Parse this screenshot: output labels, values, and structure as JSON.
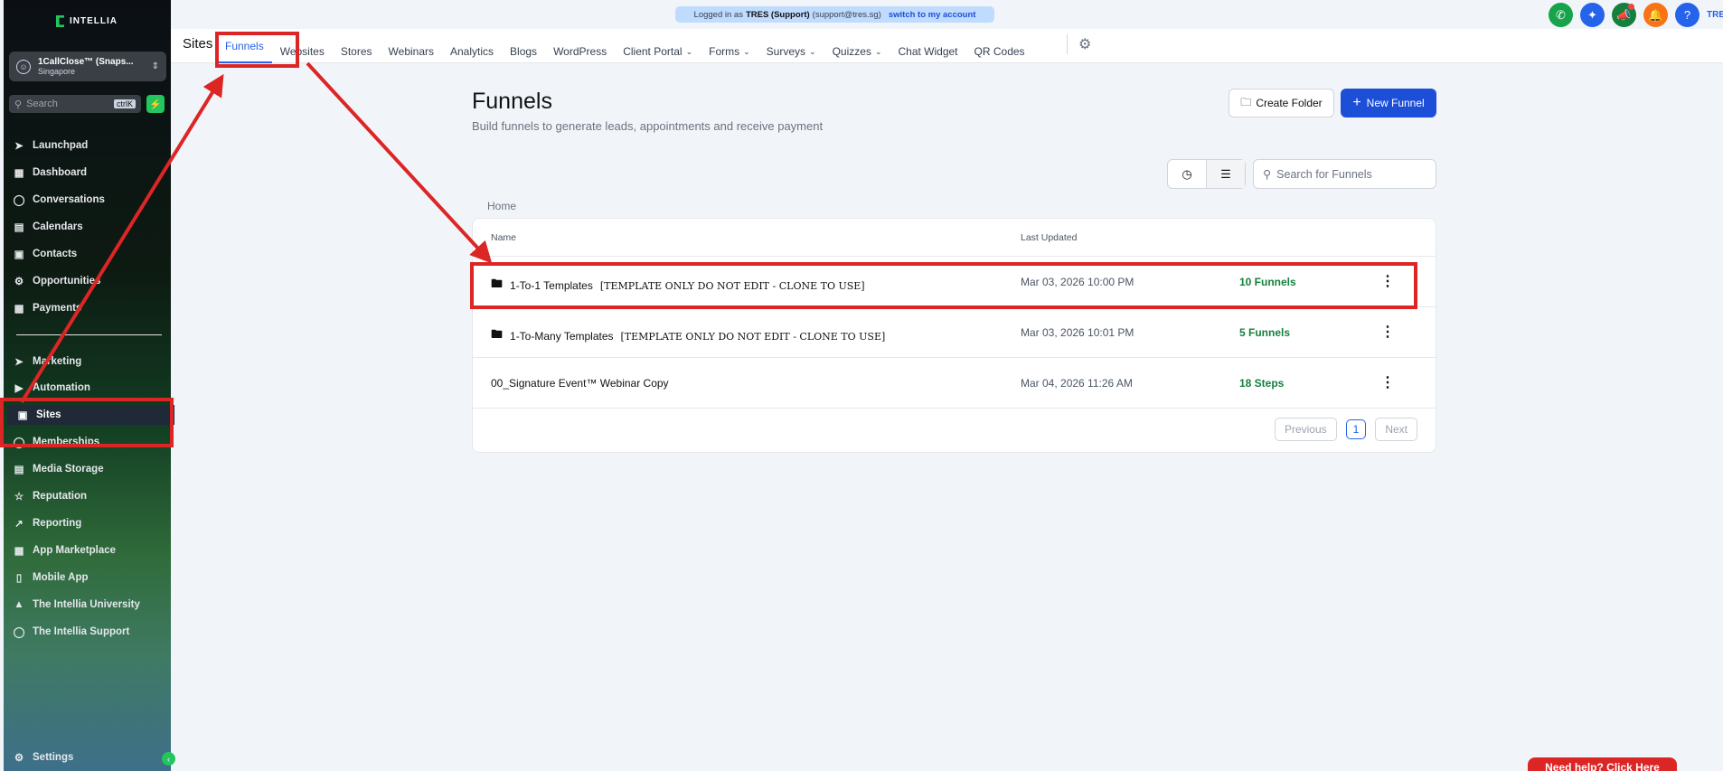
{
  "brand": "INTELLIA",
  "account": {
    "name": "1CallClose™ (Snaps...",
    "location": "Singapore"
  },
  "sidebar_search": {
    "placeholder": "Search",
    "shortcut": "ctrlK"
  },
  "nav": [
    {
      "label": "Launchpad",
      "icon": "rocket-icon"
    },
    {
      "label": "Dashboard",
      "icon": "grid-icon"
    },
    {
      "label": "Conversations",
      "icon": "chat-icon"
    },
    {
      "label": "Calendars",
      "icon": "calendar-icon"
    },
    {
      "label": "Contacts",
      "icon": "contacts-icon"
    },
    {
      "label": "Opportunities",
      "icon": "opportunities-icon"
    },
    {
      "label": "Payments",
      "icon": "payments-icon"
    },
    {
      "label": "Marketing",
      "icon": "send-icon"
    },
    {
      "label": "Automation",
      "icon": "automation-icon"
    },
    {
      "label": "Sites",
      "icon": "sites-icon"
    },
    {
      "label": "Memberships",
      "icon": "memberships-icon"
    },
    {
      "label": "Media Storage",
      "icon": "image-icon"
    },
    {
      "label": "Reputation",
      "icon": "star-icon"
    },
    {
      "label": "Reporting",
      "icon": "trend-icon"
    },
    {
      "label": "App Marketplace",
      "icon": "apps-icon"
    },
    {
      "label": "Mobile App",
      "icon": "phone-icon"
    },
    {
      "label": "The Intellia University",
      "icon": "graduation-icon"
    },
    {
      "label": "The Intellia Support",
      "icon": "headset-icon"
    }
  ],
  "settings_label": "Settings",
  "banner": {
    "prefix": "Logged in as",
    "user": "TRES (Support)",
    "email": "(support@tres.sg)",
    "switch": "switch to my account"
  },
  "top": {
    "section_title": "Sites",
    "tabs": [
      {
        "label": "Funnels",
        "dropdown": false
      },
      {
        "label": "Websites",
        "dropdown": false
      },
      {
        "label": "Stores",
        "dropdown": false
      },
      {
        "label": "Webinars",
        "dropdown": false
      },
      {
        "label": "Analytics",
        "dropdown": false
      },
      {
        "label": "Blogs",
        "dropdown": false
      },
      {
        "label": "WordPress",
        "dropdown": false
      },
      {
        "label": "Client Portal",
        "dropdown": true
      },
      {
        "label": "Forms",
        "dropdown": true
      },
      {
        "label": "Surveys",
        "dropdown": true
      },
      {
        "label": "Quizzes",
        "dropdown": true
      },
      {
        "label": "Chat Widget",
        "dropdown": false
      },
      {
        "label": "QR Codes",
        "dropdown": false
      }
    ],
    "right_label": "TRES"
  },
  "page": {
    "title": "Funnels",
    "subtitle": "Build funnels to generate leads, appointments and receive payment",
    "create_folder": "Create Folder",
    "new_funnel": "New Funnel",
    "search_placeholder": "Search for Funnels",
    "breadcrumb": "Home",
    "col_name": "Name",
    "col_updated": "Last Updated",
    "rows": [
      {
        "prefix": "1-To-1 Templates",
        "suffix": "[TEMPLATE ONLY DO NOT EDIT - CLONE TO USE]",
        "updated": "Mar 03, 2026 10:00 PM",
        "count": "10 Funnels",
        "folder": true
      },
      {
        "prefix": "1-To-Many Templates",
        "suffix": "[TEMPLATE ONLY DO NOT EDIT - CLONE TO USE]",
        "updated": "Mar 03, 2026 10:01 PM",
        "count": "5 Funnels",
        "folder": true
      },
      {
        "prefix": "00_Signature Event™ Webinar Copy",
        "suffix": "",
        "updated": "Mar 04, 2026 11:26 AM",
        "count": "18 Steps",
        "folder": false
      }
    ],
    "pager": {
      "prev": "Previous",
      "current": "1",
      "next": "Next"
    }
  },
  "help_button": "Need help? Click Here",
  "colors": {
    "accent": "#2563eb",
    "primary_button": "#1d4ed8",
    "annotation": "#dc2626",
    "count_green": "#15803d"
  }
}
